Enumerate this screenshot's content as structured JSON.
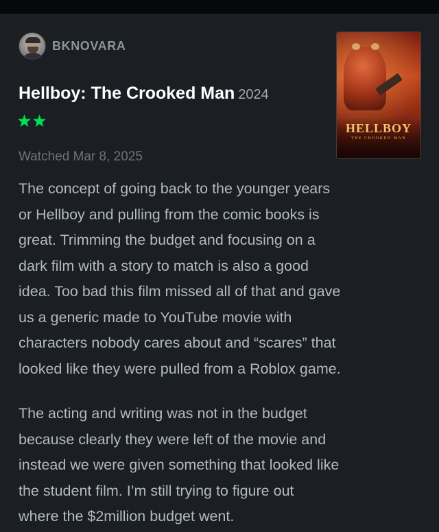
{
  "review": {
    "author": "BKNOVARA",
    "film_title": "Hellboy: The Crooked Man",
    "year": "2024",
    "rating_stars": 2,
    "star_color": "#00e054",
    "watched": "Watched Mar 8, 2025",
    "paragraph1_lines": [
      "The concept of going back to the younger years",
      "or Hellboy and pulling from the comic books is",
      "great. Trimming the budget and focusing on a",
      "dark film with a story to match is also a good",
      "idea. Too bad this film missed all of that and gave",
      "us a generic made to YouTube movie with",
      "characters nobody cares about and “scares” that",
      "looked like they were pulled from a Roblox game."
    ],
    "paragraph2_lines": [
      "The acting and writing was not in the budget",
      "because clearly they were left of the movie and",
      "instead we were given something that looked like",
      "the student film. I’m still trying to figure out",
      "where the $2million budget went."
    ],
    "poster": {
      "logo_text": "HELLBOY",
      "tagline": "THE CROOKED MAN"
    }
  }
}
